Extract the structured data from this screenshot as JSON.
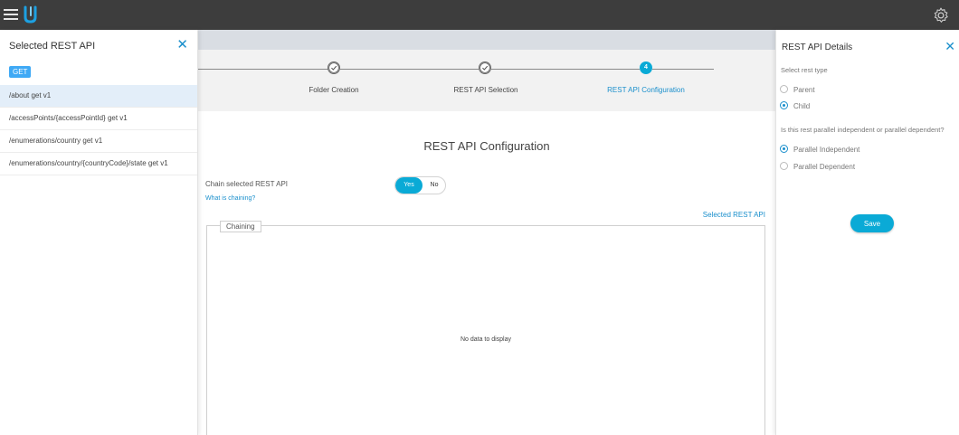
{
  "left_panel": {
    "title": "Selected REST API",
    "method": "GET",
    "items": [
      "/about get v1",
      "/accessPoints/{accessPointId} get v1",
      "/enumerations/country get v1",
      "/enumerations/country/{countryCode}/state get v1"
    ],
    "active_index": 0
  },
  "stepper": {
    "steps": [
      {
        "label": "Folder Creation",
        "state": "done"
      },
      {
        "label": "REST API Selection",
        "state": "done"
      },
      {
        "label": "REST API Configuration",
        "state": "current",
        "number": "4"
      }
    ]
  },
  "main": {
    "title": "REST API Configuration",
    "chain_label": "Chain selected REST API",
    "chain_help": "What is chaining?",
    "toggle": {
      "yes": "Yes",
      "no": "No",
      "selected": "Yes"
    },
    "selected_link": "Selected REST API",
    "chaining_legend": "Chaining",
    "empty_text": "No data to display"
  },
  "right_panel": {
    "title": "REST API Details",
    "rest_type_question": "Select rest type",
    "rest_type_options": [
      "Parent",
      "Child"
    ],
    "rest_type_selected": "Child",
    "parallel_question": "Is this rest parallel independent or parallel dependent?",
    "parallel_options": [
      "Parallel Independent",
      "Parallel Dependent"
    ],
    "parallel_selected": "Parallel Independent",
    "save_label": "Save"
  },
  "colors": {
    "topbar": "#3d3d3d",
    "accent": "#0aaad6",
    "link": "#1a8fcc",
    "active_row": "#e3eef9"
  }
}
